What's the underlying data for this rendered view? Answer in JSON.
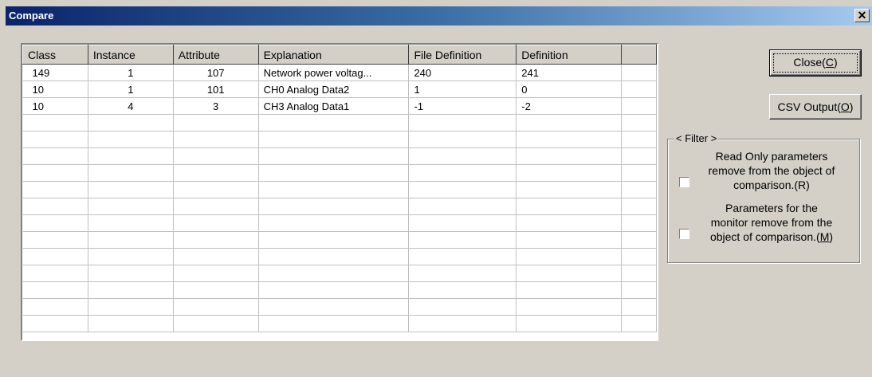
{
  "window": {
    "title": "Compare",
    "close_glyph": "✕"
  },
  "table": {
    "columns": [
      "Class",
      "Instance",
      "Attribute",
      "Explanation",
      "File Definition",
      "Definition",
      ""
    ],
    "rows": [
      [
        "149",
        "1",
        "107",
        "Network power voltag...",
        "240",
        "241",
        ""
      ],
      [
        "10",
        "1",
        "101",
        "CH0 Analog Data2",
        "1",
        "0",
        ""
      ],
      [
        "10",
        "4",
        "3",
        "CH3 Analog Data1",
        "-1",
        "-2",
        ""
      ]
    ],
    "empty_rows": 13
  },
  "buttons": {
    "close": {
      "label": "Close(",
      "key": "C",
      "suffix": ")"
    },
    "csv": {
      "label": "CSV Output(",
      "key": "O",
      "suffix": ")"
    }
  },
  "filter": {
    "legend": "< Filter >",
    "read_only": {
      "line1": "Read Only parameters",
      "line2": "remove from the object of",
      "line3": "comparison.(R)",
      "checked": false
    },
    "monitor": {
      "line1": "Parameters for the",
      "line2": "monitor remove from the",
      "line3a": "object of comparison.(",
      "key": "M",
      "line3b": ")",
      "checked": false
    }
  }
}
